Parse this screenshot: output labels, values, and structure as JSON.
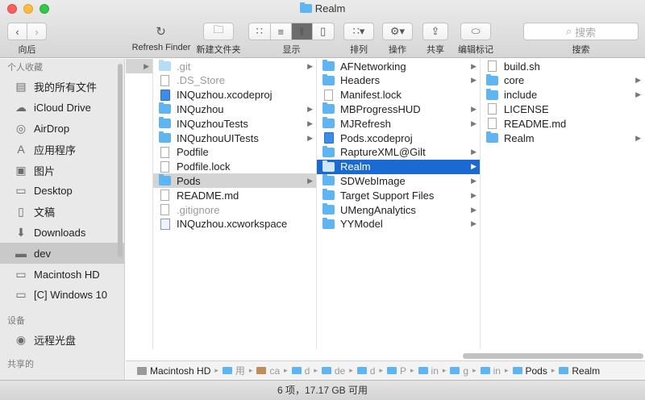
{
  "window": {
    "title": "Realm"
  },
  "toolbar": {
    "back_label": "向后",
    "refresh_label": "Refresh Finder",
    "new_folder_label": "新建文件夹",
    "view_label": "显示",
    "sort_label": "排列",
    "action_label": "操作",
    "share_label": "共享",
    "tags_label": "编辑标记",
    "search_label": "搜索",
    "search_placeholder": "搜索",
    "view_modes": [
      "icon",
      "list",
      "column",
      "gallery"
    ],
    "active_view": "column"
  },
  "sidebar": {
    "favorites_header": "个人收藏",
    "favorites": [
      {
        "label": "我的所有文件",
        "icon": "all-files-icon"
      },
      {
        "label": "iCloud Drive",
        "icon": "cloud-icon"
      },
      {
        "label": "AirDrop",
        "icon": "airdrop-icon"
      },
      {
        "label": "应用程序",
        "icon": "applications-icon"
      },
      {
        "label": "图片",
        "icon": "camera-icon"
      },
      {
        "label": "Desktop",
        "icon": "desktop-icon"
      },
      {
        "label": "文稿",
        "icon": "document-icon"
      },
      {
        "label": "Downloads",
        "icon": "download-icon"
      },
      {
        "label": "dev",
        "icon": "folder-icon",
        "active": true
      },
      {
        "label": "Macintosh HD",
        "icon": "disk-icon"
      },
      {
        "label": "[C] Windows 10",
        "icon": "disk-icon"
      }
    ],
    "devices_header": "设备",
    "devices": [
      {
        "label": "远程光盘",
        "icon": "disc-icon"
      }
    ],
    "shared_header": "共享的"
  },
  "columns": [
    {
      "items": [
        {
          "label": ".git",
          "kind": "folder",
          "dim": true,
          "arrow": true
        },
        {
          "label": ".DS_Store",
          "kind": "doc",
          "dim": true
        },
        {
          "label": "INQuzhou.xcodeproj",
          "kind": "proj"
        },
        {
          "label": "INQuzhou",
          "kind": "folder",
          "arrow": true
        },
        {
          "label": "INQuzhouTests",
          "kind": "folder",
          "arrow": true
        },
        {
          "label": "INQuzhouUITests",
          "kind": "folder",
          "arrow": true
        },
        {
          "label": "Podfile",
          "kind": "doc"
        },
        {
          "label": "Podfile.lock",
          "kind": "doc"
        },
        {
          "label": "Pods",
          "kind": "folder",
          "arrow": true,
          "selected": "gray"
        },
        {
          "label": "README.md",
          "kind": "doc"
        },
        {
          "label": ".gitignore",
          "kind": "doc",
          "dim": true
        },
        {
          "label": "INQuzhou.xcworkspace",
          "kind": "ws"
        }
      ]
    },
    {
      "items": [
        {
          "label": "AFNetworking",
          "kind": "folder",
          "arrow": true
        },
        {
          "label": "Headers",
          "kind": "folder",
          "arrow": true
        },
        {
          "label": "Manifest.lock",
          "kind": "doc"
        },
        {
          "label": "MBProgressHUD",
          "kind": "folder",
          "arrow": true
        },
        {
          "label": "MJRefresh",
          "kind": "folder",
          "arrow": true
        },
        {
          "label": "Pods.xcodeproj",
          "kind": "proj"
        },
        {
          "label": "RaptureXML@Gilt",
          "kind": "folder",
          "arrow": true
        },
        {
          "label": "Realm",
          "kind": "folder",
          "arrow": true,
          "selected": "blue"
        },
        {
          "label": "SDWebImage",
          "kind": "folder",
          "arrow": true
        },
        {
          "label": "Target Support Files",
          "kind": "folder",
          "arrow": true
        },
        {
          "label": "UMengAnalytics",
          "kind": "folder",
          "arrow": true
        },
        {
          "label": "YYModel",
          "kind": "folder",
          "arrow": true
        }
      ]
    },
    {
      "items": [
        {
          "label": "build.sh",
          "kind": "doc"
        },
        {
          "label": "core",
          "kind": "folder",
          "arrow": true
        },
        {
          "label": "include",
          "kind": "folder",
          "arrow": true
        },
        {
          "label": "LICENSE",
          "kind": "doc"
        },
        {
          "label": "README.md",
          "kind": "doc"
        },
        {
          "label": "Realm",
          "kind": "folder",
          "arrow": true
        }
      ]
    }
  ],
  "pathbar": {
    "segments": [
      {
        "label": "Macintosh HD",
        "icon": "hd"
      },
      {
        "label": "用",
        "icon": "folder",
        "trunc": true
      },
      {
        "label": "ca",
        "icon": "home",
        "trunc": true
      },
      {
        "label": "d",
        "icon": "folder",
        "trunc": true
      },
      {
        "label": "de",
        "icon": "folder",
        "trunc": true
      },
      {
        "label": "d",
        "icon": "folder",
        "trunc": true
      },
      {
        "label": "P",
        "icon": "folder",
        "trunc": true
      },
      {
        "label": "in",
        "icon": "folder",
        "trunc": true
      },
      {
        "label": "g",
        "icon": "folder",
        "trunc": true
      },
      {
        "label": "in",
        "icon": "folder",
        "trunc": true
      },
      {
        "label": "Pods",
        "icon": "folder"
      },
      {
        "label": "Realm",
        "icon": "folder"
      }
    ]
  },
  "status": {
    "text": "6 项，17.17 GB 可用"
  }
}
